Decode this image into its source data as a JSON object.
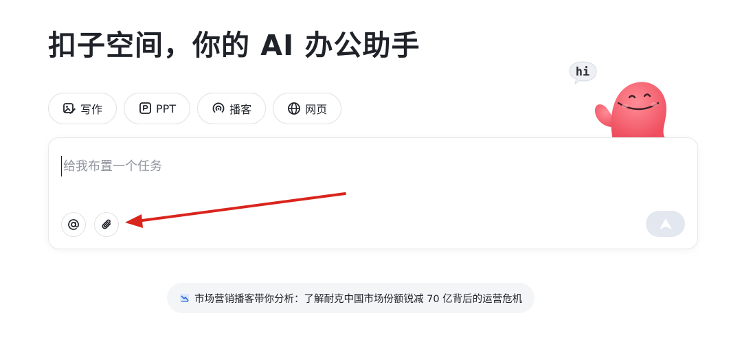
{
  "header": {
    "title": "扣子空间，你的 AI 办公助手"
  },
  "mascot": {
    "greeting": "hi",
    "color": "#f2616e"
  },
  "chips": [
    {
      "label": "写作",
      "icon": "write-icon"
    },
    {
      "label": "PPT",
      "icon": "ppt-icon"
    },
    {
      "label": "播客",
      "icon": "podcast-icon"
    },
    {
      "label": "网页",
      "icon": "globe-icon"
    }
  ],
  "composer": {
    "placeholder": "给我布置一个任务",
    "value": "",
    "mention_icon": "at-icon",
    "attach_icon": "paperclip-icon",
    "send_icon": "send-arrow-icon"
  },
  "annotation": {
    "color": "#d9251d",
    "points_to": "attach-button"
  },
  "suggestion": {
    "icon": "podcast-chart-icon",
    "text": "市场营销播客带你分析：了解耐克中国市场份额锐减 70 亿背后的运营危机"
  },
  "colors": {
    "border": "#dfe1e5",
    "send_disabled": "#e3e7f0",
    "placeholder": "#8f959e",
    "suggestion_bg": "#f4f5f7"
  }
}
